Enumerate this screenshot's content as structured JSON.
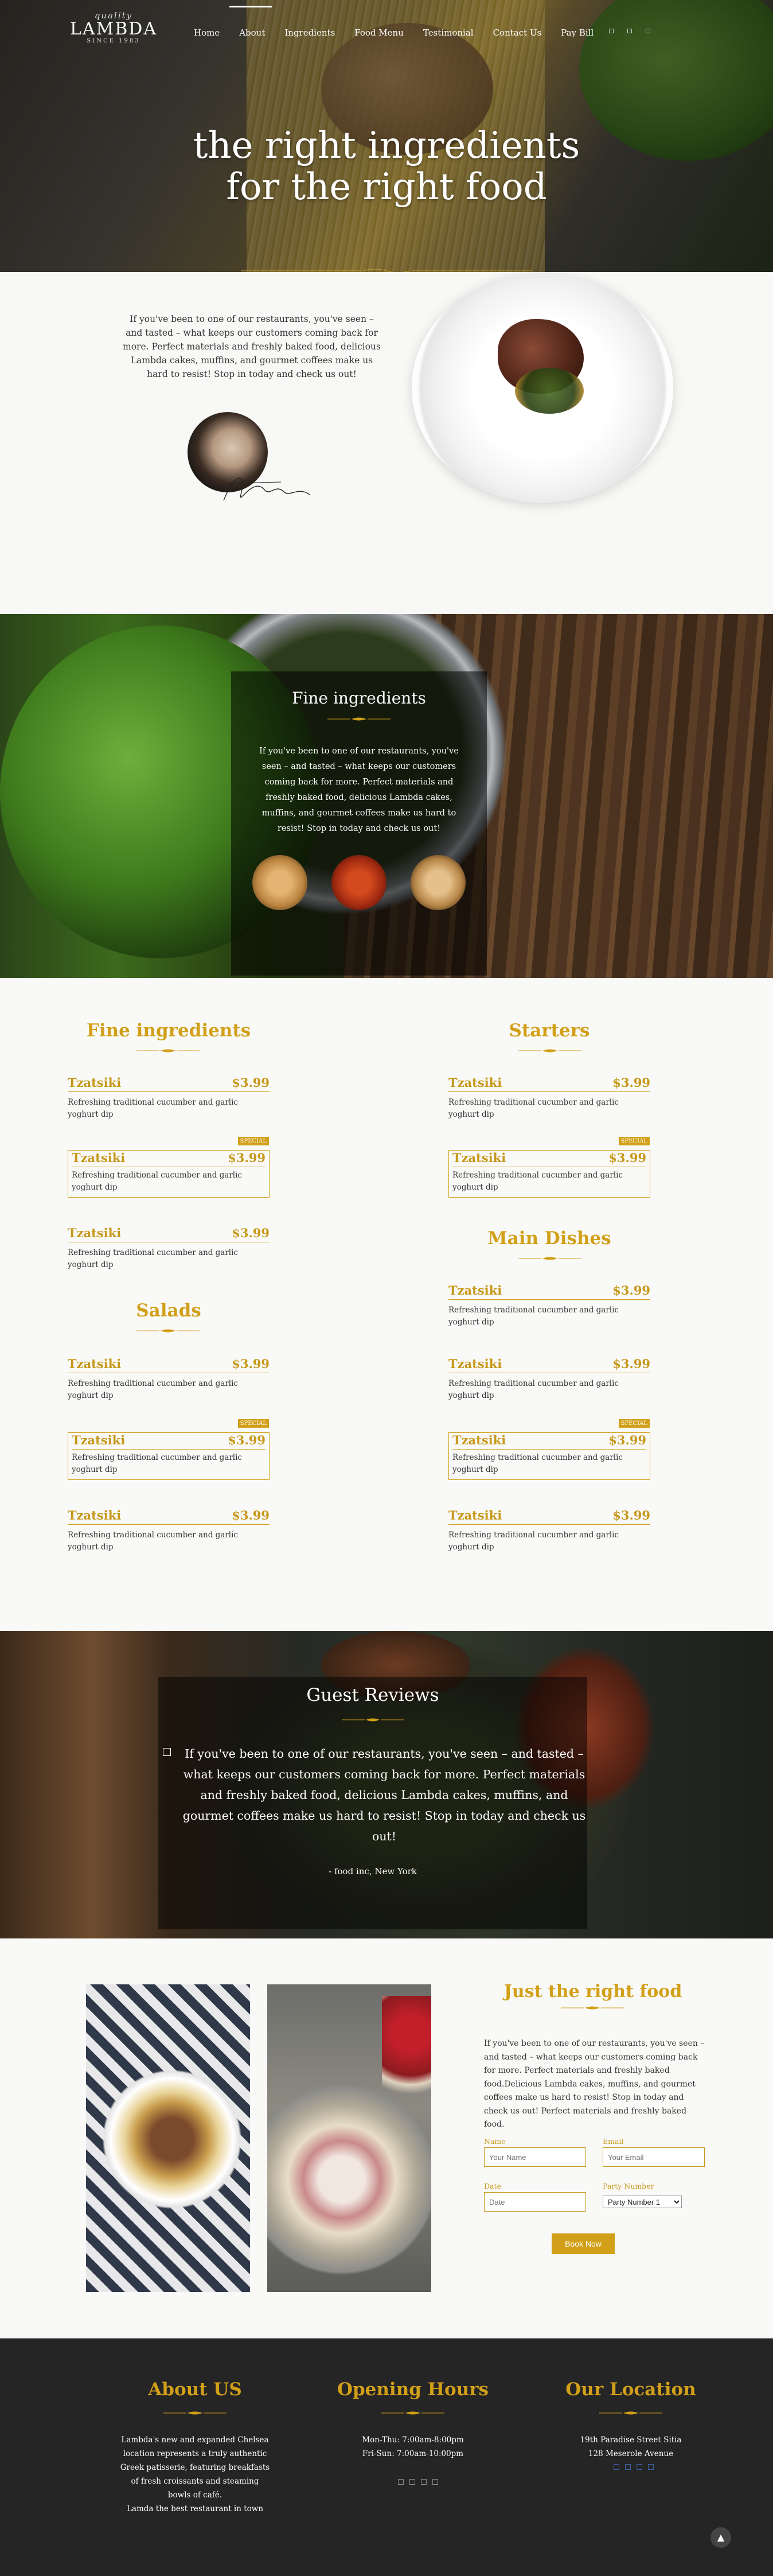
{
  "brand": {
    "top": "quality",
    "name": "LAMBDA",
    "bottom": "SINCE 1983"
  },
  "nav": [
    "Home",
    "About",
    "Ingredients",
    "Food Menu",
    "Testimonial",
    "Contact Us",
    "Pay Bill"
  ],
  "hero": {
    "line1": "the right ingredients",
    "line2": "for the right food"
  },
  "intro": {
    "text": "If you've been to one of our restaurants, you've seen – and tasted – what keeps our customers coming back for more. Perfect materials and freshly baked food, delicious Lambda cakes, muffins, and gourmet coffees make us hard to resist! Stop in today and check us out!"
  },
  "fine": {
    "title": "Fine ingredients",
    "text": "If you've been to one of our restaurants, you've seen – and tasted – what keeps our customers coming back for more. Perfect materials and freshly baked food, delicious Lambda cakes, muffins, and gourmet coffees make us hard to resist! Stop in today and check us out!"
  },
  "menu": {
    "left_title": "Fine ingredients",
    "salads_title": "Salads",
    "starters_title": "Starters",
    "main_title": "Main Dishes",
    "item_name": "Tzatsiki",
    "item_price": "$3.99",
    "item_desc": "Refreshing traditional cucumber and garlic yoghurt dip",
    "special_label": "SPECIAL"
  },
  "reviews": {
    "title": "Guest Reviews",
    "text": "If you've been to one of our restaurants, you've seen – and tasted – what keeps our customers coming back for more. Perfect materials and freshly baked food, delicious Lambda cakes, muffins, and gourmet coffees make us hard to resist! Stop in today and check us out!",
    "author": "- food inc, New York"
  },
  "booking": {
    "title": "Just the right food",
    "text": "If you've been to one of our restaurants, you've seen – and tasted – what keeps our customers coming back for more. Perfect materials and freshly baked food.Delicious Lambda cakes, muffins, and gourmet coffees make us hard to resist! Stop in today and check us out! Perfect materials and freshly baked food.",
    "name_label": "Name",
    "name_placeholder": "Your Name",
    "email_label": "Email",
    "email_placeholder": "Your Email",
    "date_label": "Date",
    "date_placeholder": "Date",
    "party_label": "Party Number",
    "party_value": "Party Number 1",
    "button": "Book Now"
  },
  "footer": {
    "about_title": "About US",
    "about_text": [
      "Lambda's new and expanded Chelsea",
      "location represents a truly authentic",
      "Greek patisserie, featuring breakfasts",
      "of fresh croissants and steaming",
      "bowls of café.",
      "Lamda the best restaurant in town"
    ],
    "hours_title": "Opening Hours",
    "hours_text": [
      "Mon-Thu: 7:00am-8:00pm",
      "Fri-Sun: 7:00am-10:00pm"
    ],
    "loc_title": "Our Location",
    "loc_text": [
      "19th Paradise Street Sitia",
      "128 Meserole Avenue"
    ]
  },
  "colors": {
    "accent": "#d2a018",
    "footer_bg": "#252525"
  }
}
